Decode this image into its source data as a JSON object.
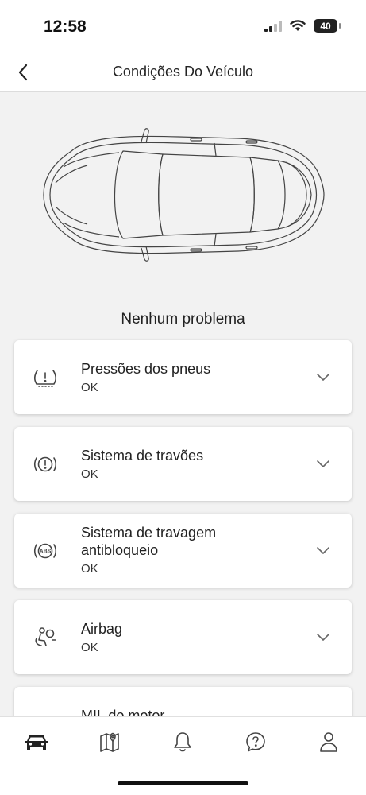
{
  "status_bar": {
    "time": "12:58",
    "battery_level": "40",
    "icons": [
      "signal-icon",
      "wifi-icon",
      "battery-icon"
    ]
  },
  "header": {
    "title": "Condições Do Veículo",
    "back_icon": "chevron-left-icon"
  },
  "vehicle": {
    "image": "car-top-view",
    "summary": "Nenhum problema"
  },
  "conditions": [
    {
      "icon": "tire-pressure-icon",
      "title": "Pressões dos pneus",
      "status": "OK"
    },
    {
      "icon": "brake-warning-icon",
      "title": "Sistema de travões",
      "status": "OK"
    },
    {
      "icon": "abs-icon",
      "title_line1": "Sistema de travagem",
      "title_line2": "antibloqueio",
      "status": "OK"
    },
    {
      "icon": "airbag-icon",
      "title": "Airbag",
      "status": "OK"
    },
    {
      "title": "MIL do motor"
    }
  ],
  "tab_bar": {
    "tabs": [
      {
        "icon": "car-icon",
        "active": true
      },
      {
        "icon": "map-icon",
        "active": false
      },
      {
        "icon": "bell-icon",
        "active": false
      },
      {
        "icon": "help-icon",
        "active": false
      },
      {
        "icon": "profile-icon",
        "active": false
      }
    ]
  },
  "colors": {
    "background": "#f2f2f2",
    "card": "#ffffff",
    "text": "#222222",
    "icon": "#444444"
  }
}
